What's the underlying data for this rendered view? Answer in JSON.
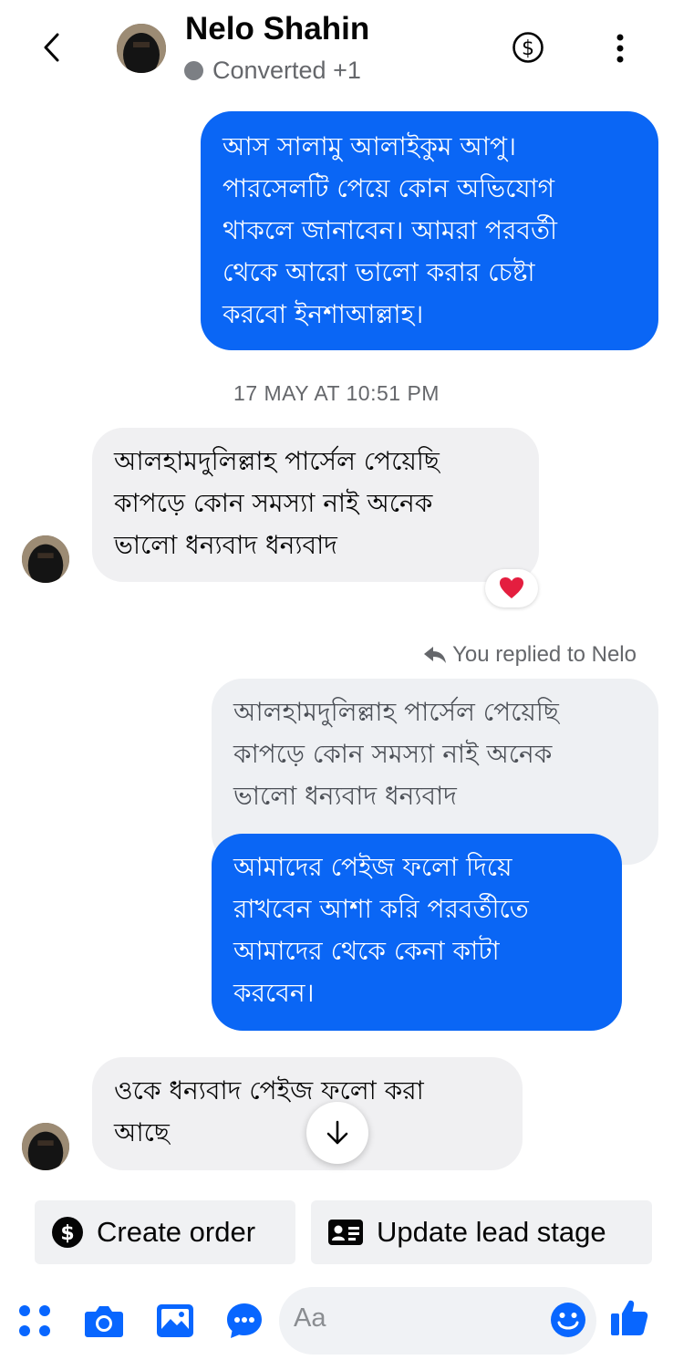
{
  "header": {
    "contact_name": "Nelo Shahin",
    "status": "Converted +1"
  },
  "messages": [
    {
      "direction": "outgoing",
      "text": "আস সালামু আলাইকুম আপু।\nপারসেলটি পেয়ে কোন অভিযোগ\nথাকলে জানাবেন। আমরা পরবর্তী\nথেকে আরো ভালো করার চেষ্টা\nকরবো ইনশাআল্লাহ।"
    },
    {
      "direction": "incoming",
      "text": "আলহামদুলিল্লাহ পার্সেল পেয়েছি\nকাপড়ে কোন সমস্যা নাই অনেক\nভালো ধন্যবাদ ধন্যবাদ",
      "reaction": "❤️"
    },
    {
      "direction": "quoted",
      "text": "আলহামদুলিল্লাহ পার্সেল পেয়েছি\nকাপড়ে কোন সমস্যা নাই অনেক\nভালো ধন্যবাদ ধন্যবাদ"
    },
    {
      "direction": "outgoing",
      "text": "আমাদের পেইজ ফলো দিয়ে\nরাখবেন আশা করি পরবর্তীতে\nআমাদের থেকে কেনা কাটা\nকরবেন।"
    },
    {
      "direction": "incoming",
      "text": "ওকে ধন্যবাদ পেইজ ফলো করা\nআছে"
    }
  ],
  "timestamp": "17 MAY AT 10:51 PM",
  "reply_note": "You replied to Nelo",
  "quick_actions": {
    "create_order": "Create order",
    "update_lead_stage": "Update lead stage"
  },
  "composer": {
    "placeholder": "Aa"
  },
  "colors": {
    "outgoing_bubble": "#0a66f5",
    "incoming_bubble": "#f0f0f2",
    "accent": "#0866ff"
  }
}
